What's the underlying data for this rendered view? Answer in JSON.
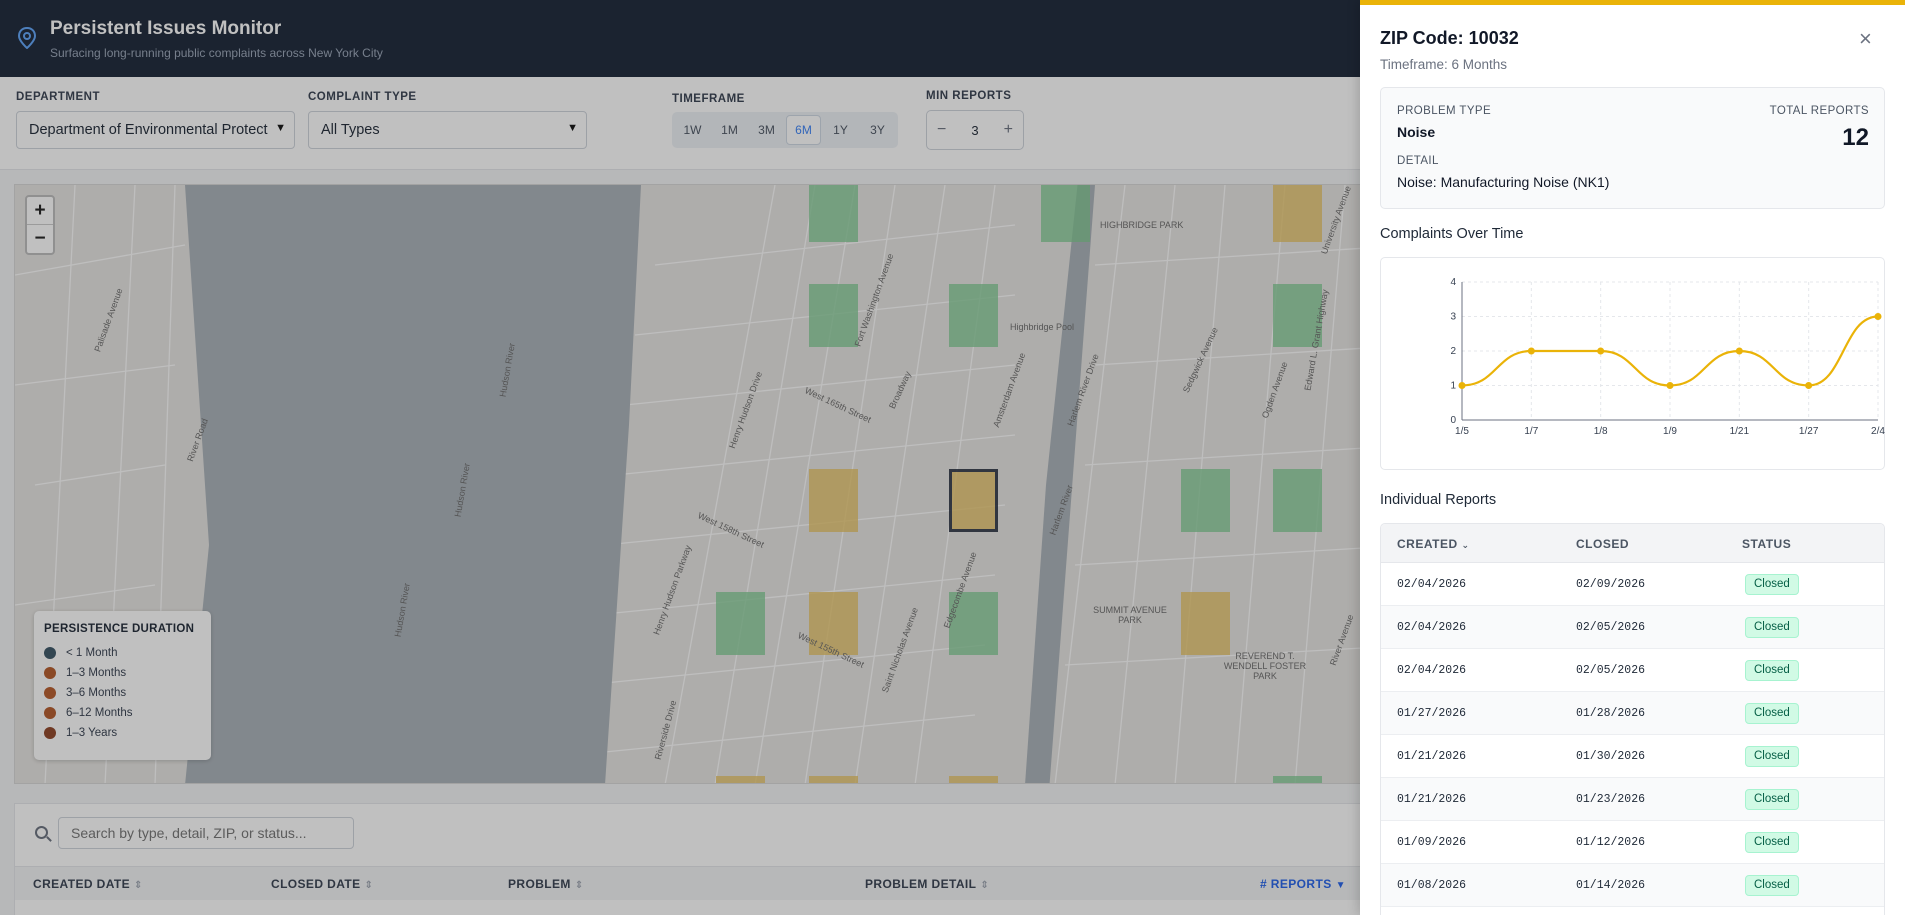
{
  "header": {
    "title": "Persistent Issues Monitor",
    "subtitle": "Surfacing long-running public complaints across New York City"
  },
  "filters": {
    "department_label": "DEPARTMENT",
    "department_value": "Department of Environmental Protect",
    "complaint_label": "COMPLAINT TYPE",
    "complaint_value": "All Types",
    "timeframe_label": "TIMEFRAME",
    "timeframes": [
      "1W",
      "1M",
      "3M",
      "6M",
      "1Y",
      "3Y"
    ],
    "timeframe_selected": "6M",
    "min_reports_label": "MIN REPORTS",
    "min_reports_value": "3",
    "minus": "−",
    "plus": "+"
  },
  "map": {
    "zoom_in": "+",
    "zoom_out": "−",
    "labels": [
      "HIGHBRIDGE PARK",
      "Highbridge Pool",
      "Palisade Avenue",
      "River Road",
      "Hudson River",
      "Hudson River",
      "Hudson River",
      "Henry Hudson Drive",
      "Fort Washington Avenue",
      "West 165th Street",
      "Broadway",
      "Amsterdam Avenue",
      "Harlem River Drive",
      "Harlem River",
      "Sedgwick Avenue",
      "Ogden Avenue",
      "Edgecombe Avenue",
      "Saint Nicholas Avenue",
      "West 155th Street",
      "Henry Hudson Parkway",
      "West 158th Street",
      "SUMMIT AVENUE PARK",
      "REVEREND T. WENDELL FOSTER PARK",
      "Riverside Drive",
      "River Avenue",
      "University Avenue",
      "Edward L. Grant Highway"
    ],
    "legend": {
      "title": "PERSISTENCE DURATION",
      "items": [
        {
          "label": "< 1 Month",
          "color": "#3b5566"
        },
        {
          "label": "1–3 Months",
          "color": "#b45a2a"
        },
        {
          "label": "3–6 Months",
          "color": "#b85c2c"
        },
        {
          "label": "6–12 Months",
          "color": "#b55a2b"
        },
        {
          "label": "1–3 Years",
          "color": "#8f4427"
        }
      ]
    }
  },
  "search": {
    "placeholder": "Search by type, detail, ZIP, or status..."
  },
  "main_table": {
    "columns": [
      "CREATED DATE",
      "CLOSED DATE",
      "PROBLEM",
      "PROBLEM DETAIL",
      "# REPORTS"
    ]
  },
  "panel": {
    "title": "ZIP Code: 10032",
    "subtitle": "Timeframe: 6 Months",
    "close": "×",
    "problem_type_label": "PROBLEM TYPE",
    "problem_type": "Noise",
    "total_reports_label": "TOTAL REPORTS",
    "total_reports": "12",
    "detail_label": "DETAIL",
    "detail": "Noise: Manufacturing Noise (NK1)",
    "chart_title": "Complaints Over Time",
    "reports_title": "Individual Reports",
    "report_columns": [
      "CREATED",
      "CLOSED",
      "STATUS"
    ],
    "reports": [
      {
        "created": "02/04/2026",
        "closed": "02/09/2026",
        "status": "Closed"
      },
      {
        "created": "02/04/2026",
        "closed": "02/05/2026",
        "status": "Closed"
      },
      {
        "created": "02/04/2026",
        "closed": "02/05/2026",
        "status": "Closed"
      },
      {
        "created": "01/27/2026",
        "closed": "01/28/2026",
        "status": "Closed"
      },
      {
        "created": "01/21/2026",
        "closed": "01/30/2026",
        "status": "Closed"
      },
      {
        "created": "01/21/2026",
        "closed": "01/23/2026",
        "status": "Closed"
      },
      {
        "created": "01/09/2026",
        "closed": "01/12/2026",
        "status": "Closed"
      },
      {
        "created": "01/08/2026",
        "closed": "01/14/2026",
        "status": "Closed"
      }
    ]
  },
  "chart_data": {
    "type": "line",
    "categories": [
      "1/5",
      "1/7",
      "1/8",
      "1/9",
      "1/21",
      "1/27",
      "2/4"
    ],
    "series": [
      {
        "values": [
          1,
          2,
          2,
          1,
          2,
          1,
          3
        ]
      }
    ],
    "yticks": [
      "0",
      "1",
      "2",
      "3",
      "4"
    ],
    "ylim": [
      0,
      4
    ],
    "color": "#eab308"
  },
  "colors": {
    "accent": "#eab308",
    "header_bg": "#1b2638",
    "tile_green": "#7ec990",
    "tile_yellow": "#e9c465"
  }
}
